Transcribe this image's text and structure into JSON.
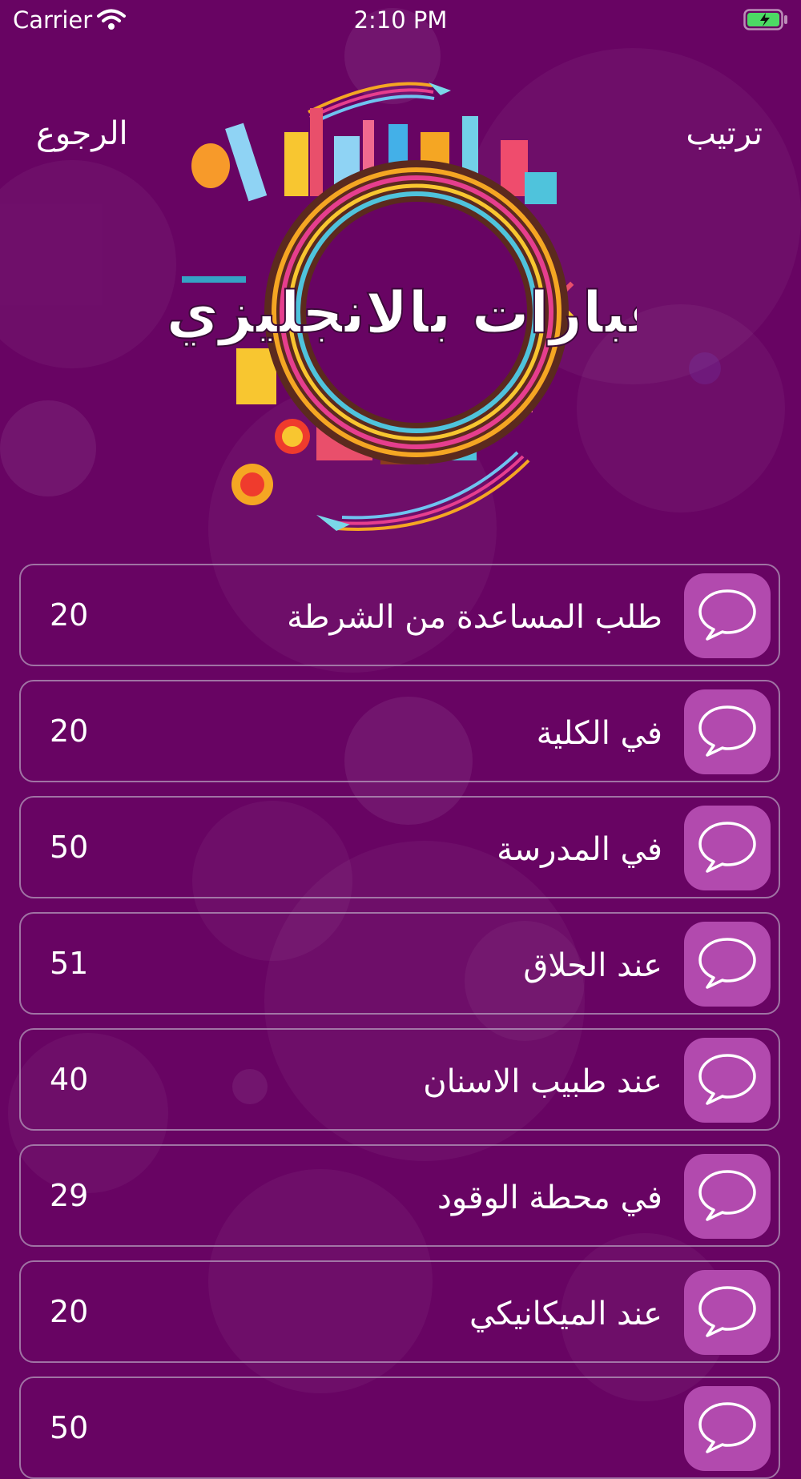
{
  "status_bar": {
    "carrier": "Carrier",
    "time": "2:10 PM",
    "battery_color": "#4cd964"
  },
  "nav": {
    "back_label": "الرجوع",
    "sort_label": "ترتيب"
  },
  "logo": {
    "text": "عبارات بالانجليزي"
  },
  "list": [
    {
      "title": "طلب المساعدة من الشرطة",
      "count": "20",
      "icon": "speech-bubble-icon"
    },
    {
      "title": "في الكلية",
      "count": "20",
      "icon": "speech-bubble-icon"
    },
    {
      "title": "في المدرسة",
      "count": "50",
      "icon": "speech-bubble-icon"
    },
    {
      "title": "عند الحلاق",
      "count": "51",
      "icon": "speech-bubble-icon"
    },
    {
      "title": "عند طبيب الاسنان",
      "count": "40",
      "icon": "speech-bubble-icon"
    },
    {
      "title": "في محطة الوقود",
      "count": "29",
      "icon": "speech-bubble-icon"
    },
    {
      "title": "عند الميكانيكي",
      "count": "20",
      "icon": "speech-bubble-icon"
    },
    {
      "title": "",
      "count": "50",
      "icon": "speech-bubble-icon"
    }
  ],
  "colors": {
    "background": "#680463",
    "icon_tile": "#b24aae",
    "border": "#beafc8"
  }
}
